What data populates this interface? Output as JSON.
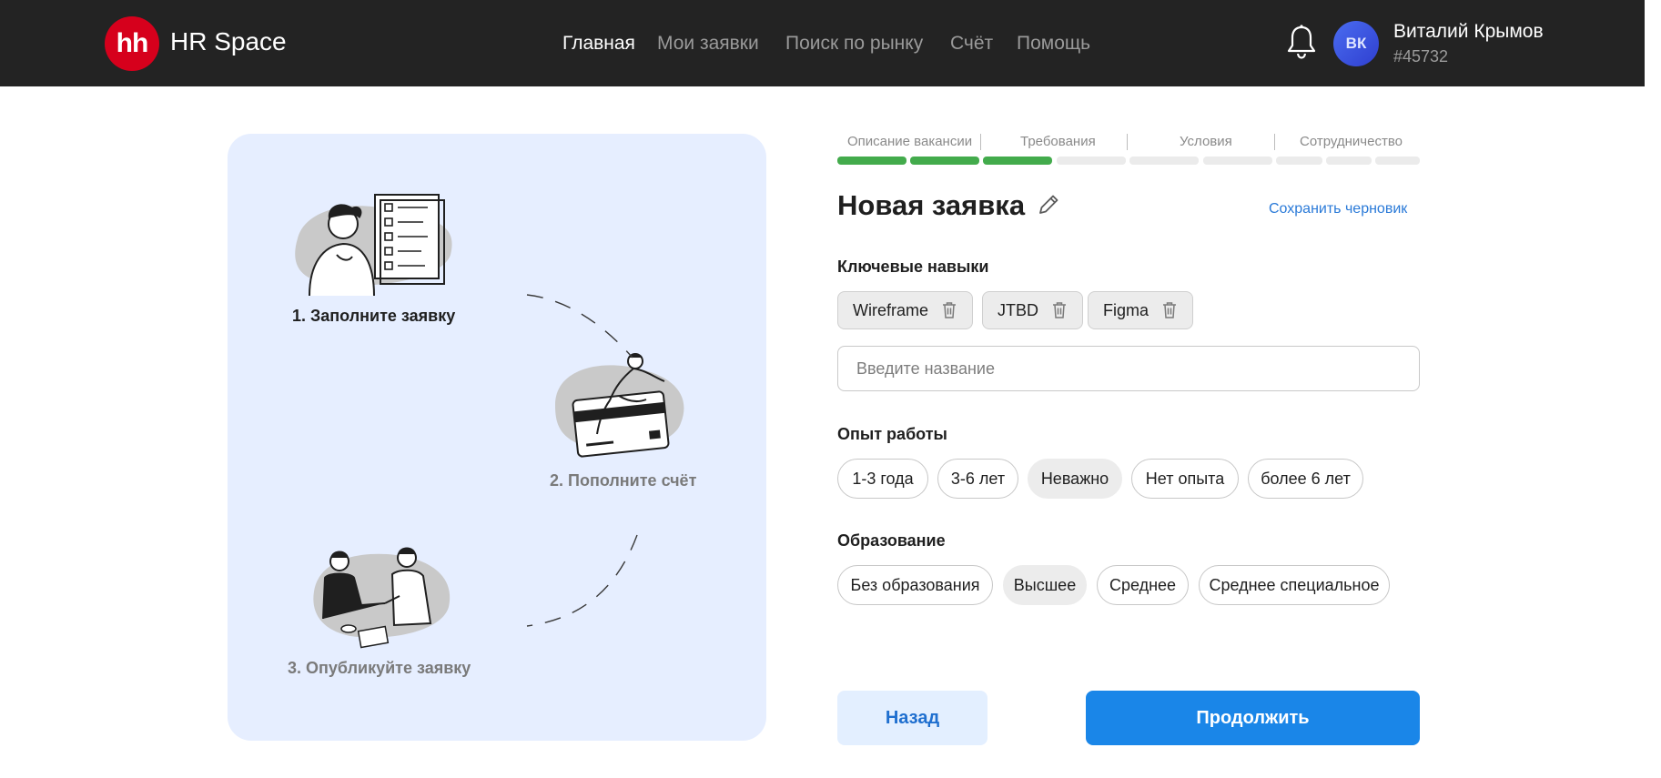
{
  "header": {
    "logo_text": "hh",
    "brand": "HR Space",
    "nav": [
      "Главная",
      "Мои заявки",
      "Поиск по рынку",
      "Счёт",
      "Помощь"
    ],
    "active_nav": "Главная",
    "user": {
      "initials": "ВК",
      "name": "Виталий Крымов",
      "id": "#45732"
    },
    "icons": {
      "notifications": "bell-icon"
    },
    "colors": {
      "bar": "#232323",
      "logo": "#d6001c",
      "avatar": "#3a52e0"
    }
  },
  "steps": [
    {
      "label": "1. Заполните заявку",
      "state": "done"
    },
    {
      "label": "2. Пополните счёт",
      "state": "todo"
    },
    {
      "label": "3. Опубликуйте заявку",
      "state": "todo"
    }
  ],
  "progress": {
    "labels": [
      "Описание вакансии",
      "Требования",
      "Условия",
      "Сотрудничество"
    ],
    "segments_filled": 3,
    "segments_total": 10,
    "color": "#43ab4c"
  },
  "form": {
    "title": "Новая заявка",
    "save_draft": "Сохранить черновик",
    "skills": {
      "label": "Ключевые навыки",
      "tags": [
        "Wireframe",
        "JTBD",
        "Figma"
      ],
      "placeholder": "Введите название"
    },
    "experience": {
      "label": "Опыт работы",
      "options": [
        "1-3 года",
        "3-6 лет",
        "Неважно",
        "Нет опыта",
        "более 6 лет"
      ],
      "selected": "Неважно"
    },
    "education": {
      "label": "Образование",
      "options": [
        "Без образования",
        "Высшее",
        "Среднее",
        "Среднее специальное"
      ],
      "selected": "Высшее"
    },
    "buttons": {
      "back": "Назад",
      "next": "Продолжить"
    },
    "accent": "#1a86e8"
  }
}
